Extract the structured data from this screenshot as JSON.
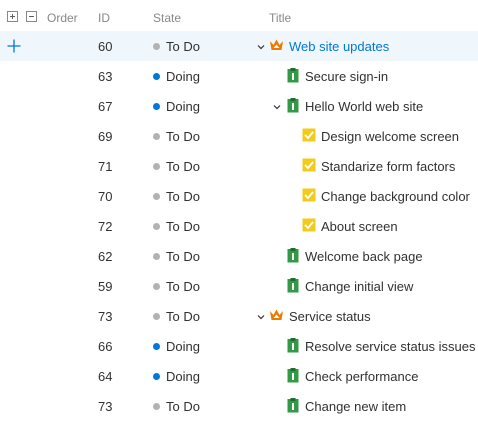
{
  "columns": {
    "order": "Order",
    "id": "ID",
    "state": "State",
    "title": "Title"
  },
  "colors": {
    "todo": "#b2b2b2",
    "doing": "#0078d4",
    "epic": "#ec7a00",
    "backlog": "#339947",
    "task": "#f2cb1d",
    "link": "#0078d4"
  },
  "rows": [
    {
      "id": "60",
      "state": "To Do",
      "status": "todo",
      "title": "Web site updates",
      "type": "epic",
      "level": 0,
      "expanded": true,
      "selected": true
    },
    {
      "id": "63",
      "state": "Doing",
      "status": "doing",
      "title": "Secure sign-in",
      "type": "backlog",
      "level": 1,
      "expanded": false
    },
    {
      "id": "67",
      "state": "Doing",
      "status": "doing",
      "title": "Hello World web site",
      "type": "backlog",
      "level": 1,
      "expanded": true
    },
    {
      "id": "69",
      "state": "To Do",
      "status": "todo",
      "title": "Design welcome screen",
      "type": "task",
      "level": 2
    },
    {
      "id": "71",
      "state": "To Do",
      "status": "todo",
      "title": "Standarize form factors",
      "type": "task",
      "level": 2
    },
    {
      "id": "70",
      "state": "To Do",
      "status": "todo",
      "title": "Change background color",
      "type": "task",
      "level": 2
    },
    {
      "id": "72",
      "state": "To Do",
      "status": "todo",
      "title": "About screen",
      "type": "task",
      "level": 2
    },
    {
      "id": "62",
      "state": "To Do",
      "status": "todo",
      "title": "Welcome back page",
      "type": "backlog",
      "level": 1
    },
    {
      "id": "59",
      "state": "To Do",
      "status": "todo",
      "title": "Change initial view",
      "type": "backlog",
      "level": 1
    },
    {
      "id": "73",
      "state": "To Do",
      "status": "todo",
      "title": "Service status",
      "type": "epic",
      "level": 0,
      "expanded": true
    },
    {
      "id": "66",
      "state": "Doing",
      "status": "doing",
      "title": "Resolve service status issues",
      "type": "backlog",
      "level": 1
    },
    {
      "id": "64",
      "state": "Doing",
      "status": "doing",
      "title": "Check performance",
      "type": "backlog",
      "level": 1
    },
    {
      "id": "73",
      "state": "To Do",
      "status": "todo",
      "title": "Change new item",
      "type": "backlog",
      "level": 1
    }
  ]
}
